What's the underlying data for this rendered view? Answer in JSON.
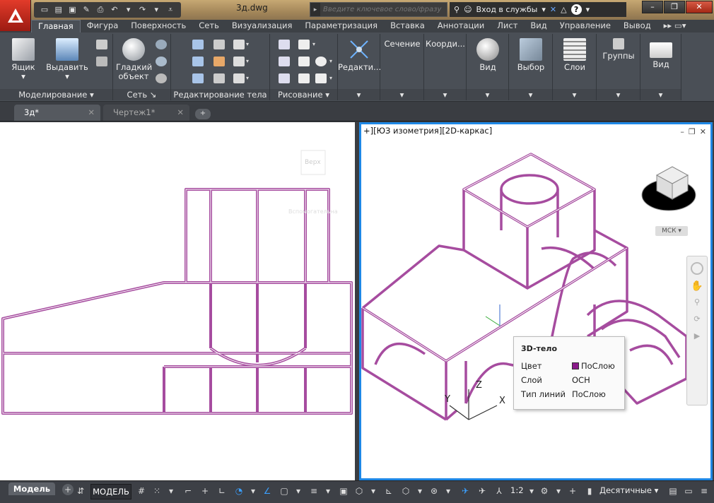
{
  "title_bar": {
    "filename": "3д.dwg",
    "search_placeholder": "Введите ключевое слово/фразу",
    "signin": "Вход в службы",
    "help": "?"
  },
  "ribbon_tabs": [
    "Главная",
    "Фигура",
    "Поверхность",
    "Сеть",
    "Визуализация",
    "Параметризация",
    "Вставка",
    "Аннотации",
    "Лист",
    "Вид",
    "Управление",
    "Вывод"
  ],
  "ribbon": {
    "modeling": {
      "label": "Моделирование",
      "box": "Ящик",
      "extrude": "Выдавить"
    },
    "mesh": {
      "label": "Сеть",
      "smooth1": "Гладкий",
      "smooth2": "объект"
    },
    "solid_edit": {
      "label": "Редактирование тела"
    },
    "draw": {
      "label": "Рисование"
    },
    "edit": {
      "label": "Редакти..."
    },
    "section": {
      "label": "Сечение"
    },
    "coords": {
      "label": "Коорди..."
    },
    "view1": {
      "label": "Вид"
    },
    "selection": {
      "label": "Выбор"
    },
    "layers": {
      "label": "Слои"
    },
    "groups": {
      "label": "Группы"
    },
    "view2": {
      "label": "Вид"
    }
  },
  "doc_tabs": [
    {
      "label": "3д*"
    },
    {
      "label": "Чертеж1*"
    }
  ],
  "left_viewport": {
    "viewcube_label": "Верх",
    "faded_text": "Вспомогательная"
  },
  "right_viewport": {
    "label": "+][ЮЗ изометрия][2D-каркас]",
    "cube_label": "МСК",
    "axis_x": "X",
    "axis_y": "Y",
    "axis_z": "Z"
  },
  "tooltip": {
    "title": "3D-тело",
    "rows": [
      {
        "key": "Цвет",
        "value": "ПоСлою"
      },
      {
        "key": "Слой",
        "value": "ОСН"
      },
      {
        "key": "Тип линий",
        "value": "ПоСлою"
      }
    ],
    "swatch_color": "#8a1a8a"
  },
  "status": {
    "model_tab": "Модель",
    "model_btn": "МОДЕЛЬ",
    "scale": "1:2",
    "units": "Десятичные"
  },
  "colors": {
    "accent": "#1e87e5",
    "edge": "#a64c9f"
  }
}
